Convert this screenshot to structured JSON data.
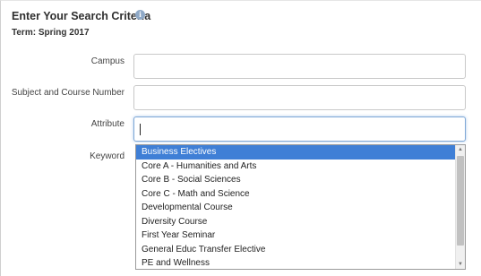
{
  "header": {
    "title": "Enter Your Search Criteria",
    "info_icon": "info-circle-icon",
    "term": "Term: Spring 2017"
  },
  "form": {
    "campus_label": "Campus",
    "campus_value": "",
    "subject_label": "Subject and Course Number",
    "subject_value": "",
    "attribute_label": "Attribute",
    "attribute_value": "",
    "keyword_label": "Keyword",
    "keyword_value": ""
  },
  "dropdown": {
    "items": [
      "Business Electives",
      "Core A - Humanities and Arts",
      "Core B - Social Sciences",
      "Core C - Math and Science",
      "Developmental Course",
      "Diversity Course",
      "First Year Seminar",
      "General Educ Transfer Elective",
      "PE and Wellness"
    ],
    "highlighted_item": "Business Electives"
  },
  "colors": {
    "highlight": "#3f7fd6",
    "focus_border": "#7ea7d6",
    "info_icon": "#8fa9c7"
  }
}
